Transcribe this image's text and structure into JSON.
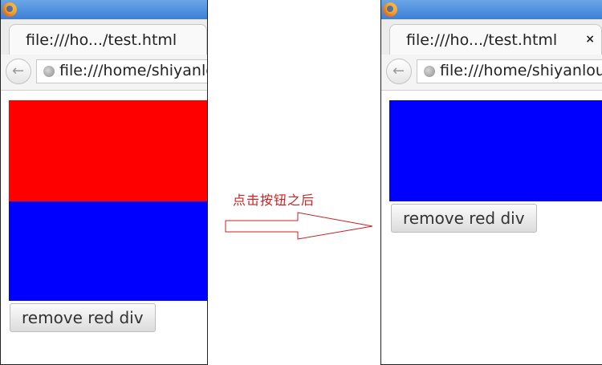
{
  "before": {
    "tab_label": "file:///ho.../test.html",
    "url": "file:///home/shiyanlou/test.html",
    "button_label": "remove red div"
  },
  "after": {
    "tab_label": "file:///ho.../test.html",
    "tab_close": "×",
    "url": "file:///home/shiyanlou/test.html",
    "button_label": "remove red div"
  },
  "annotation": {
    "caption": "点击按钮之后"
  },
  "colors": {
    "red_div": "#ff0000",
    "blue_div": "#0000ff",
    "arrow": "#cc2222"
  },
  "icons": [
    "firefox-icon",
    "back-arrow-icon",
    "globe-icon",
    "close-icon",
    "right-arrow"
  ]
}
